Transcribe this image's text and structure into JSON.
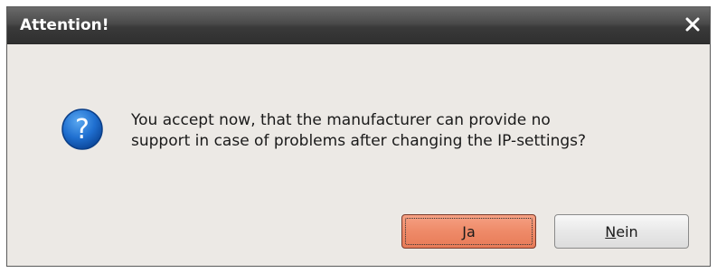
{
  "dialog": {
    "title": "Attention!",
    "message": "You accept now, that the manufacturer can provide no\nsupport in case of problems after changing the IP-settings?",
    "icon": "question-icon",
    "close_icon": "close-icon",
    "buttons": {
      "yes": {
        "mnemonic": "J",
        "rest": "a",
        "focused": true
      },
      "no": {
        "mnemonic": "N",
        "rest": "ein"
      }
    },
    "colors": {
      "titlebar": "#3a3a3a",
      "background": "#ece9e5",
      "yes_button": "#ee8a68",
      "icon_blue": "#1f6fd0"
    }
  }
}
